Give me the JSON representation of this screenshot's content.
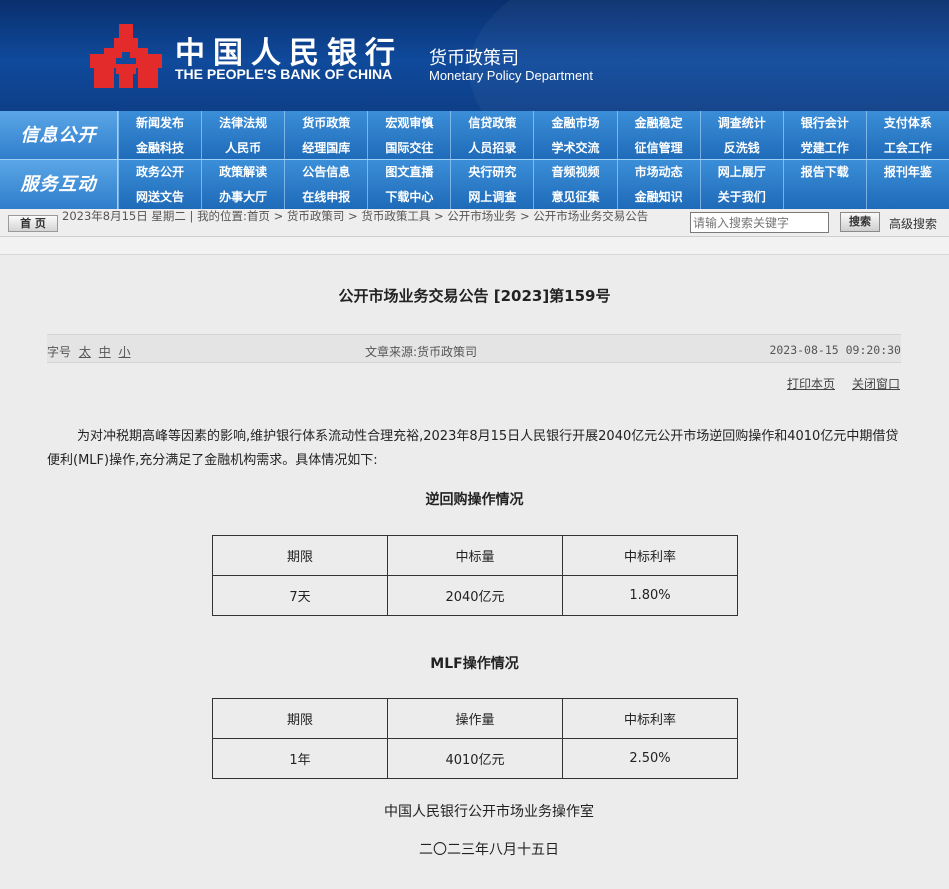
{
  "header": {
    "cn_name": "中国人民银行",
    "en_name": "THE PEOPLE'S BANK OF CHINA",
    "dept_cn": "货币政策司",
    "dept_en": "Monetary Policy Department",
    "logo_color": "#e32b2b"
  },
  "nav": {
    "info_title": "信息公开",
    "service_title": "服务互动",
    "info_row1": [
      "新闻发布",
      "法律法规",
      "货币政策",
      "宏观审慎",
      "信贷政策",
      "金融市场",
      "金融稳定",
      "调查统计",
      "银行会计",
      "支付体系"
    ],
    "info_row2": [
      "金融科技",
      "人民币",
      "经理国库",
      "国际交往",
      "人员招录",
      "学术交流",
      "征信管理",
      "反洗钱",
      "党建工作",
      "工会工作"
    ],
    "service_row1": [
      "政务公开",
      "政策解读",
      "公告信息",
      "图文直播",
      "央行研究",
      "音频视频",
      "市场动态",
      "网上展厅",
      "报告下载",
      "报刊年鉴"
    ],
    "service_row2": [
      "网送文告",
      "办事大厅",
      "在线申报",
      "下载中心",
      "网上调查",
      "意见征集",
      "金融知识",
      "关于我们",
      "",
      ""
    ]
  },
  "breadcrumb": {
    "home_label": "首 页",
    "date": "2023年8月15日 星期二",
    "location_prefix": "我的位置:",
    "items": [
      "首页",
      "货币政策司",
      "货币政策工具",
      "公开市场业务",
      "公开市场业务交易公告"
    ],
    "separator": ">"
  },
  "search": {
    "placeholder": "请输入搜索关键字",
    "button_label": "搜索",
    "advanced_label": "高级搜索"
  },
  "article": {
    "title": "公开市场业务交易公告 [2023]第159号",
    "font_size_label": "字号",
    "font_sizes": [
      "太",
      "中",
      "小"
    ],
    "source": "文章来源:货币政策司",
    "datetime": "2023-08-15 09:20:30",
    "print_label": "打印本页",
    "close_label": "关闭窗口",
    "paragraph": "为对冲税期高峰等因素的影响,维护银行体系流动性合理充裕,2023年8月15日人民银行开展2040亿元公开市场逆回购操作和4010亿元中期借贷便利(MLF)操作,充分满足了金融机构需求。具体情况如下:",
    "table1": {
      "heading": "逆回购操作情况",
      "headers": [
        "期限",
        "中标量",
        "中标利率"
      ],
      "row": [
        "7天",
        "2040亿元",
        "1.80%"
      ]
    },
    "table2": {
      "heading": "MLF操作情况",
      "headers": [
        "期限",
        "操作量",
        "中标利率"
      ],
      "row": [
        "1年",
        "4010亿元",
        "2.50%"
      ]
    },
    "sign_org": "中国人民银行公开市场业务操作室",
    "sign_date": "二〇二三年八月十五日"
  }
}
